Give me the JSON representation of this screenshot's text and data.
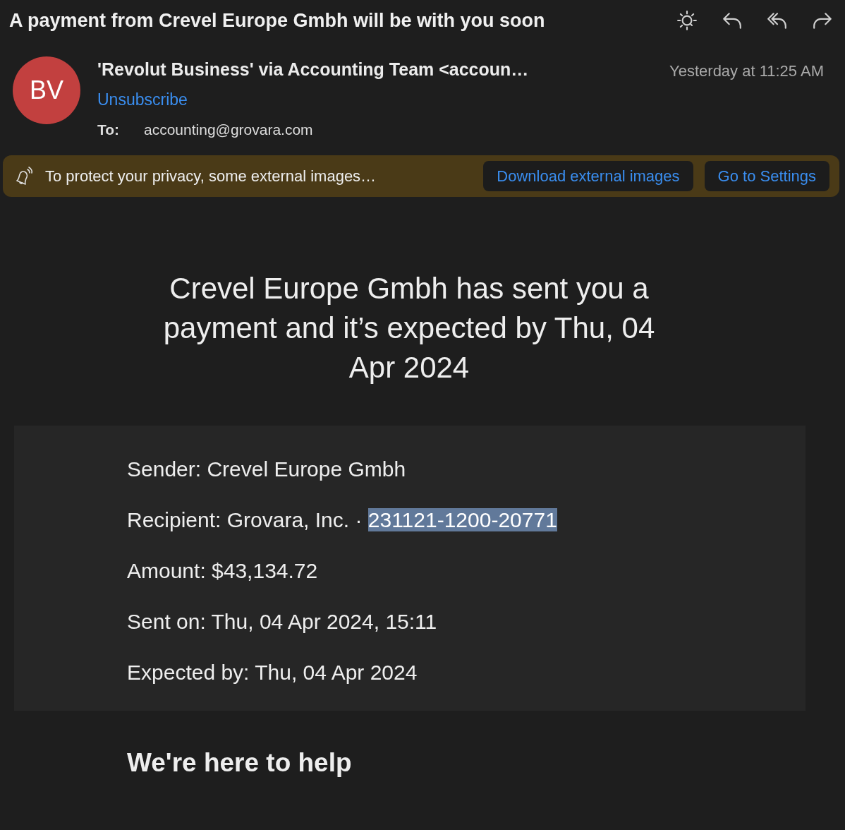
{
  "toolbar": {
    "subject": "A payment from Crevel Europe Gmbh will be with you soon",
    "actions": [
      {
        "kind": "theme"
      },
      {
        "kind": "reply"
      },
      {
        "kind": "reply_all"
      },
      {
        "kind": "forward"
      }
    ]
  },
  "header": {
    "avatar": "BV",
    "from": "'Revolut Business' via Accounting Team <accoun…",
    "unsubscribe": "Unsubscribe",
    "to_label": "To:",
    "to": "accounting@grovara.com",
    "time": "Yesterday at 11:25 AM"
  },
  "privacy_bar": {
    "message": "To protect your privacy, some external images…",
    "buttons": [
      "Download external images",
      "Go to Settings"
    ]
  },
  "email": {
    "headline": "Crevel Europe Gmbh has sent you a payment and it’s expected by Thu, 04 Apr 2024",
    "details": [
      [
        {
          "text": "Sender: Crevel Europe Gmbh",
          "selected": false
        }
      ],
      [
        {
          "text": "Recipient: Grovara, Inc. · ",
          "selected": false
        },
        {
          "text": "231121-1200-20771",
          "selected": true
        }
      ],
      [
        {
          "text": "Amount: $43,134.72",
          "selected": false
        }
      ],
      [
        {
          "text": "Sent on: Thu, 04 Apr 2024, 15:11",
          "selected": false
        }
      ],
      [
        {
          "text": "Expected by: Thu, 04 Apr 2024",
          "selected": false
        }
      ]
    ],
    "help_heading": "We're here to help"
  }
}
